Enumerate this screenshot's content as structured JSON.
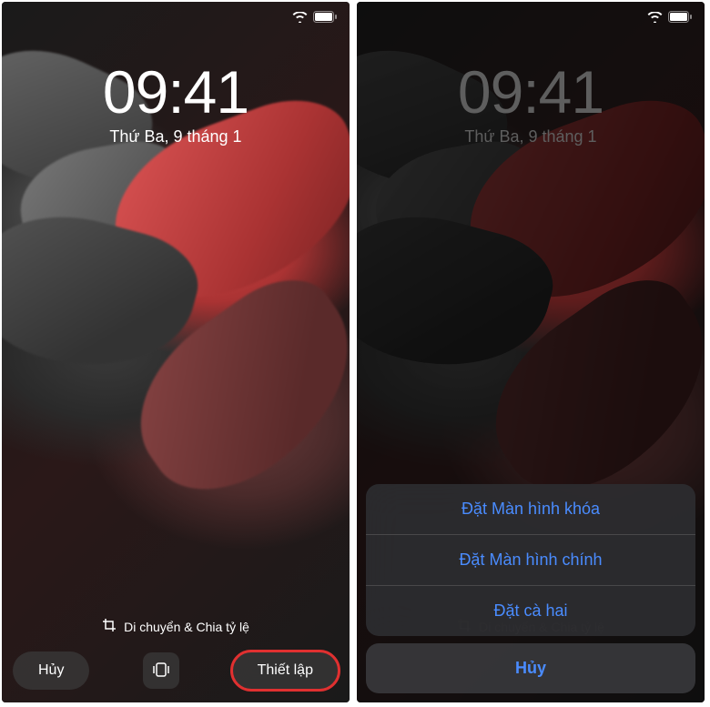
{
  "left": {
    "time": "09:41",
    "date": "Thứ Ba, 9 tháng 1",
    "crop_hint": "Di chuyển & Chia tỷ lệ",
    "cancel_label": "Hủy",
    "set_label": "Thiết lập"
  },
  "right": {
    "time": "09:41",
    "date": "Thứ Ba, 9 tháng 1",
    "crop_hint": "Di chuyển & Chia tỷ lệ",
    "actions": {
      "set_lock": "Đặt Màn hình khóa",
      "set_home": "Đặt Màn hình chính",
      "set_both": "Đặt cà hai",
      "cancel": "Hủy"
    }
  }
}
